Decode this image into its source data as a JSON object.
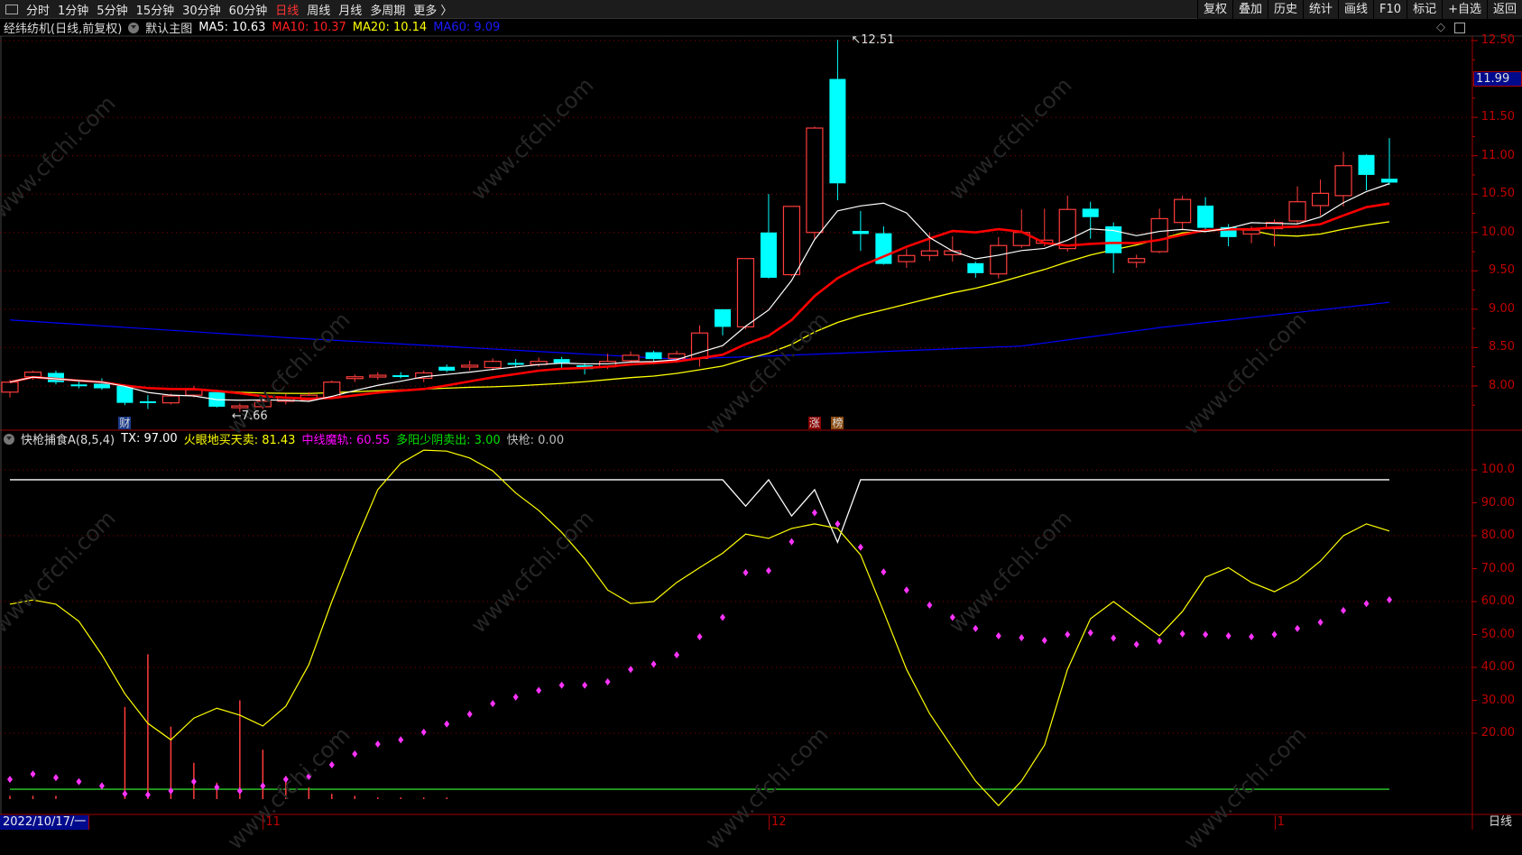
{
  "toolbar": {
    "nav": [
      "分时",
      "1分钟",
      "5分钟",
      "15分钟",
      "30分钟",
      "60分钟",
      "日线",
      "周线",
      "月线",
      "多周期",
      "更多 〉"
    ],
    "active": "日线",
    "right": [
      "复权",
      "叠加",
      "历史",
      "统计",
      "画线",
      "F10",
      "标记",
      "+自选",
      "返回"
    ]
  },
  "info": {
    "title": "经纬纺机(日线,前复权)",
    "main_chart": "默认主图",
    "ma5": "MA5: 10.63",
    "ma10": "MA10: 10.37",
    "ma20": "MA20: 10.14",
    "ma60": "MA60: 9.09"
  },
  "colors": {
    "up": "#ff3c3c",
    "down": "#00ffff",
    "ma5": "#ffffff",
    "ma10": "#ff0000",
    "ma20": "#ffff00",
    "ma60": "#0000ff",
    "grid": "#8b0000",
    "axis": "#c00000"
  },
  "indicator": {
    "name": "快枪捕食A(8,5,4)",
    "tx": "TX: 97.00",
    "fire": "火眼地买天卖: 81.43",
    "mid": "中线魔轨: 60.55",
    "sell": "多阳少阴卖出: 3.00",
    "gun": "快枪: 0.00"
  },
  "price_axis": [
    "12.50",
    "11.50",
    "11.00",
    "10.50",
    "10.00",
    "9.50",
    "9.00",
    "8.50",
    "8.00"
  ],
  "price_axis_values": [
    12.5,
    11.5,
    11.0,
    10.5,
    10.0,
    9.5,
    9.0,
    8.5,
    8.0
  ],
  "current_price": "11.99",
  "ind_axis": [
    "100.0",
    "90.00",
    "80.00",
    "70.00",
    "60.00",
    "50.00",
    "40.00",
    "30.00",
    "20.00"
  ],
  "ind_axis_values": [
    100,
    90,
    80,
    70,
    60,
    50,
    40,
    30,
    20
  ],
  "annotations": {
    "high": "12.51",
    "high_index": 36,
    "low": "7.66",
    "low_index": 10
  },
  "markers": [
    {
      "text": "财",
      "index": 5,
      "bg": "#1a3a8a"
    },
    {
      "text": "涨",
      "index": 35,
      "bg": "#8b0000"
    },
    {
      "text": "榜",
      "index": 36,
      "bg": "#8b4a10"
    }
  ],
  "dates": {
    "start": "2022/10/17/一",
    "labels": [
      {
        "text": "11",
        "index": 11
      },
      {
        "text": "12",
        "index": 33
      },
      {
        "text": "1",
        "index": 55
      }
    ],
    "period": "日线"
  },
  "watermark": "www.cfchi.com",
  "chart_data": {
    "type": "candlestick",
    "ohlc": [
      [
        7.92,
        8.08,
        7.85,
        8.05
      ],
      [
        8.12,
        8.2,
        8.08,
        8.18
      ],
      [
        8.17,
        8.2,
        8.02,
        8.05
      ],
      [
        8.02,
        8.06,
        7.97,
        8.0
      ],
      [
        8.03,
        8.1,
        7.95,
        7.97
      ],
      [
        8.0,
        8.02,
        7.75,
        7.78
      ],
      [
        7.8,
        7.88,
        7.7,
        7.78
      ],
      [
        7.78,
        7.9,
        7.76,
        7.87
      ],
      [
        7.88,
        8.0,
        7.85,
        7.95
      ],
      [
        7.92,
        7.95,
        7.72,
        7.73
      ],
      [
        7.72,
        7.77,
        7.66,
        7.74
      ],
      [
        7.73,
        7.88,
        7.7,
        7.8
      ],
      [
        7.8,
        7.9,
        7.76,
        7.85
      ],
      [
        7.82,
        7.92,
        7.8,
        7.88
      ],
      [
        7.85,
        8.07,
        7.83,
        8.05
      ],
      [
        8.1,
        8.15,
        8.05,
        8.12
      ],
      [
        8.12,
        8.18,
        8.08,
        8.14
      ],
      [
        8.14,
        8.18,
        8.1,
        8.12
      ],
      [
        8.1,
        8.2,
        8.05,
        8.17
      ],
      [
        8.25,
        8.28,
        8.18,
        8.2
      ],
      [
        8.25,
        8.33,
        8.2,
        8.27
      ],
      [
        8.24,
        8.36,
        8.2,
        8.32
      ],
      [
        8.3,
        8.35,
        8.25,
        8.28
      ],
      [
        8.28,
        8.37,
        8.25,
        8.32
      ],
      [
        8.35,
        8.38,
        8.22,
        8.3
      ],
      [
        8.27,
        8.3,
        8.15,
        8.22
      ],
      [
        8.25,
        8.42,
        8.22,
        8.32
      ],
      [
        8.33,
        8.45,
        8.3,
        8.4
      ],
      [
        8.44,
        8.46,
        8.32,
        8.35
      ],
      [
        8.36,
        8.46,
        8.3,
        8.42
      ],
      [
        8.36,
        8.79,
        8.25,
        8.69
      ],
      [
        9.0,
        9.0,
        8.66,
        8.77
      ],
      [
        8.77,
        9.66,
        8.74,
        9.66
      ],
      [
        10.0,
        10.5,
        9.4,
        9.41
      ],
      [
        9.45,
        10.34,
        9.43,
        10.34
      ],
      [
        10.0,
        11.38,
        9.92,
        11.36
      ],
      [
        12.0,
        12.51,
        10.42,
        10.64
      ],
      [
        10.02,
        10.28,
        9.76,
        9.98
      ],
      [
        9.99,
        10.08,
        9.58,
        9.59
      ],
      [
        9.62,
        9.79,
        9.54,
        9.7
      ],
      [
        9.7,
        10.0,
        9.63,
        9.76
      ],
      [
        9.71,
        9.95,
        9.62,
        9.76
      ],
      [
        9.6,
        9.62,
        9.41,
        9.47
      ],
      [
        9.46,
        9.94,
        9.4,
        9.83
      ],
      [
        9.83,
        10.3,
        9.8,
        10.0
      ],
      [
        9.86,
        10.31,
        9.82,
        9.9
      ],
      [
        9.79,
        10.48,
        9.75,
        10.3
      ],
      [
        10.31,
        10.4,
        9.92,
        10.2
      ],
      [
        10.08,
        10.13,
        9.47,
        9.73
      ],
      [
        9.61,
        9.71,
        9.54,
        9.66
      ],
      [
        9.75,
        10.31,
        9.73,
        10.18
      ],
      [
        10.13,
        10.48,
        10.03,
        10.43
      ],
      [
        10.35,
        10.46,
        10.03,
        10.06
      ],
      [
        10.07,
        10.11,
        9.82,
        9.94
      ],
      [
        9.98,
        10.08,
        9.86,
        10.03
      ],
      [
        10.05,
        10.17,
        9.82,
        10.13
      ],
      [
        10.15,
        10.6,
        10.12,
        10.4
      ],
      [
        10.35,
        10.69,
        10.22,
        10.51
      ],
      [
        10.48,
        11.05,
        10.34,
        10.87
      ],
      [
        11.01,
        11.02,
        10.55,
        10.75
      ],
      [
        10.7,
        11.23,
        10.62,
        10.65
      ]
    ],
    "ma60_points": [
      [
        0,
        8.86
      ],
      [
        12,
        8.63
      ],
      [
        29,
        8.35
      ],
      [
        33,
        8.39
      ],
      [
        44,
        8.52
      ],
      [
        50,
        8.76
      ],
      [
        60,
        9.09
      ]
    ],
    "ylim": [
      7.5,
      12.5
    ],
    "indicator": {
      "ylim": [
        0,
        100
      ],
      "tx": [
        97,
        97,
        97,
        97,
        97,
        97,
        97,
        97,
        97,
        97,
        97,
        97,
        97,
        97,
        97,
        97,
        97,
        97,
        97,
        97,
        97,
        97,
        97,
        97,
        97,
        97,
        97,
        97,
        97,
        97,
        97,
        97,
        89,
        97,
        86,
        94,
        78,
        97,
        97,
        97,
        97,
        97,
        97,
        97,
        97,
        97,
        97,
        97,
        97,
        97,
        97,
        97,
        97,
        97,
        97,
        97,
        97,
        97,
        97,
        97,
        97
      ],
      "fire": [
        59.2,
        60.5,
        59.2,
        54,
        43.8,
        32,
        23,
        18,
        24.6,
        27.6,
        25.5,
        22.2,
        28.2,
        40.8,
        60,
        77.6,
        94,
        102,
        106,
        105.7,
        103.6,
        99.7,
        93,
        87.7,
        81,
        73,
        63.5,
        59.4,
        60,
        65.8,
        70.3,
        74.7,
        80.5,
        79.2,
        82.2,
        83.6,
        82.2,
        74.2,
        57,
        39.4,
        26,
        15.6,
        5.5,
        -2,
        5.5,
        16.4,
        39.4,
        54.8,
        60,
        54.8,
        49.6,
        57,
        67.4,
        70.3,
        65.8,
        63,
        66.6,
        72.3,
        80,
        83.6,
        81.43
      ],
      "mid": [
        6,
        7.6,
        6.5,
        5.3,
        4,
        1.6,
        1.3,
        2.5,
        5.3,
        3.6,
        2.5,
        4,
        6,
        6.9,
        10.4,
        13.7,
        16.7,
        18,
        20.3,
        22.8,
        25.8,
        29,
        31,
        33,
        34.6,
        34.6,
        35.6,
        39.4,
        41,
        43.8,
        49.3,
        55.2,
        68.8,
        69.4,
        78.2,
        87,
        83.6,
        76.5,
        69,
        63.5,
        58.9,
        55.2,
        51.8,
        49.6,
        49,
        48.2,
        50,
        50.5,
        48.9,
        47,
        48,
        50.2,
        50,
        49.6,
        49.3,
        50,
        51.8,
        53.7,
        57.3,
        59.4,
        60.55
      ],
      "sell": 3,
      "gun": [
        1,
        1,
        1,
        0,
        0,
        28,
        44,
        22,
        11,
        5,
        30,
        15,
        7,
        3.5,
        1.6,
        1,
        0.5,
        0.5,
        0.5,
        0.5,
        0,
        0,
        0,
        0,
        0,
        0,
        0,
        0,
        0,
        0,
        0,
        0,
        0,
        0,
        0,
        0,
        0,
        0,
        0,
        0,
        0,
        0,
        0,
        0,
        0,
        0,
        0,
        0,
        0,
        0,
        0,
        0,
        0,
        0,
        0,
        0,
        0,
        0,
        0,
        0,
        0
      ]
    }
  }
}
